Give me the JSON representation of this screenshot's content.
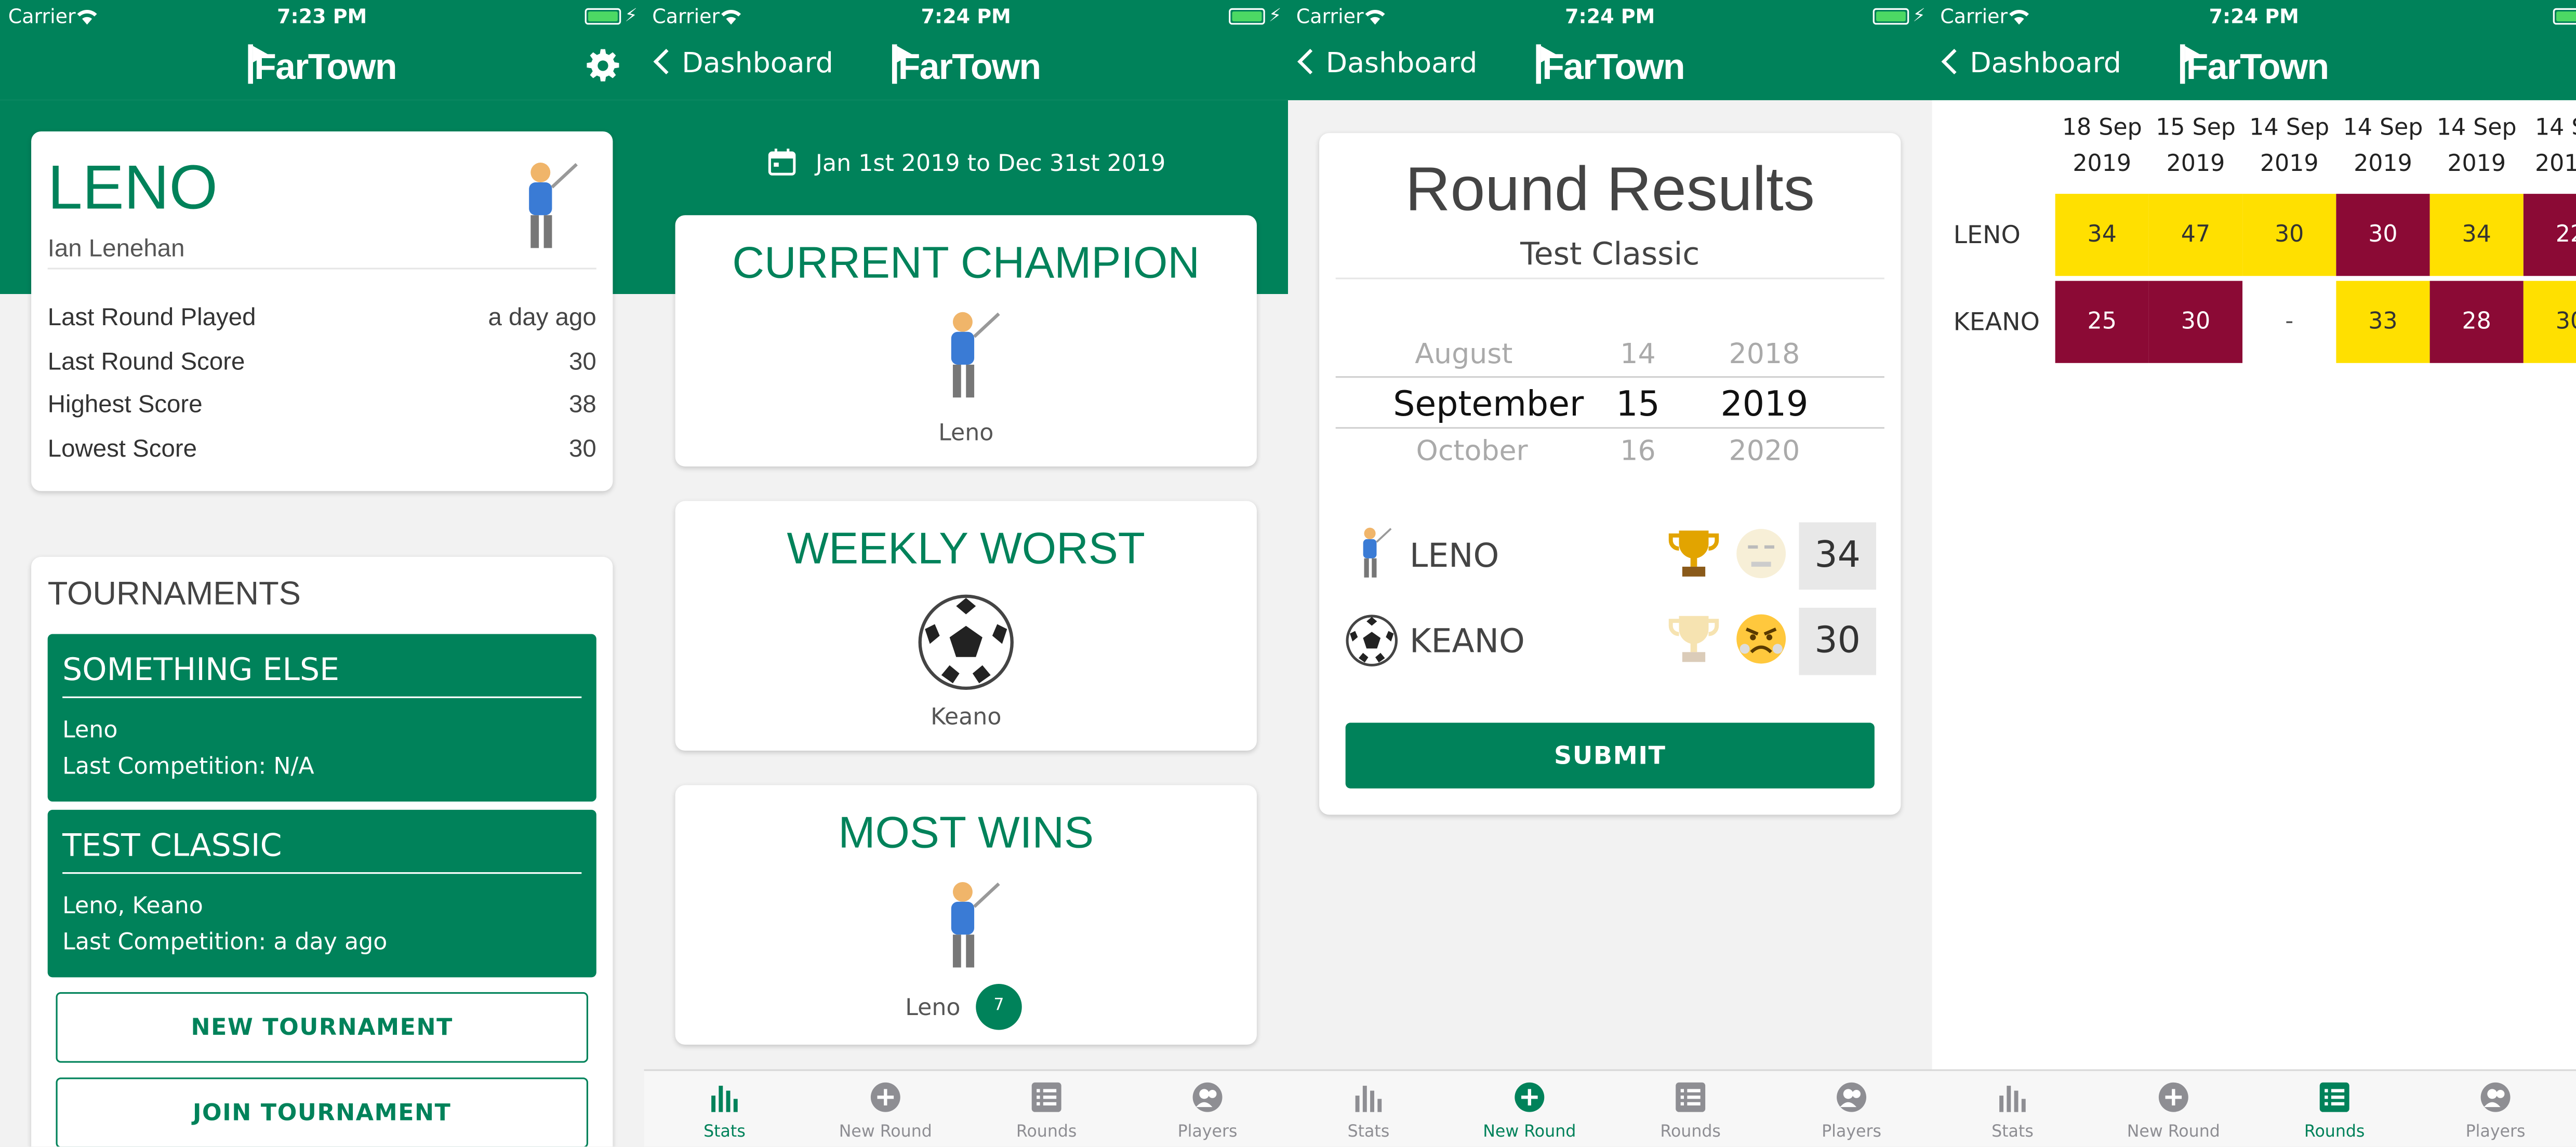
{
  "status": {
    "carrier": "Carrier",
    "times": [
      "7:23 PM",
      "7:24 PM",
      "7:24 PM",
      "7:24 PM"
    ]
  },
  "app": {
    "logo": "FarTown",
    "back_label": "Dashboard",
    "accent": "#00825a"
  },
  "tabs": [
    "Stats",
    "New Round",
    "Rounds",
    "Players"
  ],
  "profile": {
    "name": "LENO",
    "full_name": "Ian Lenehan",
    "avatar_icon": "golfer-emoji",
    "stats": [
      {
        "label": "Last Round Played",
        "value": "a day ago"
      },
      {
        "label": "Last Round Score",
        "value": "30"
      },
      {
        "label": "Highest Score",
        "value": "38"
      },
      {
        "label": "Lowest Score",
        "value": "30"
      }
    ]
  },
  "tournaments": {
    "heading": "TOURNAMENTS",
    "items": [
      {
        "name": "SOMETHING ELSE",
        "players": "Leno",
        "last": "Last Competition: N/A"
      },
      {
        "name": "TEST CLASSIC",
        "players": "Leno, Keano",
        "last": "Last Competition: a day ago"
      }
    ],
    "new_label": "NEW TOURNAMENT",
    "join_label": "JOIN TOURNAMENT"
  },
  "dashboard": {
    "date_range": "Jan 1st 2019 to Dec 31st 2019",
    "cards": [
      {
        "title": "CURRENT CHAMPION",
        "icon": "golfer-emoji",
        "name": "Leno"
      },
      {
        "title": "WEEKLY WORST",
        "icon": "soccer-ball-emoji",
        "name": "Keano"
      },
      {
        "title": "MOST WINS",
        "icon": "golfer-emoji",
        "name": "Leno",
        "count": "7"
      }
    ]
  },
  "round": {
    "title": "Round Results",
    "subtitle": "Test Classic",
    "picker": {
      "months": [
        "August",
        "September",
        "October"
      ],
      "days": [
        "14",
        "15",
        "16"
      ],
      "years": [
        "2018",
        "2019",
        "2020"
      ]
    },
    "players": [
      {
        "name": "LENO",
        "icon": "golfer-emoji",
        "trophy_active": true,
        "face_active": false,
        "score": "34"
      },
      {
        "name": "KEANO",
        "icon": "soccer-ball-emoji",
        "trophy_active": false,
        "face_active": true,
        "score": "30"
      }
    ],
    "submit_label": "SUBMIT"
  },
  "rounds": {
    "columns": [
      {
        "day": "18 Sep",
        "year": "2019"
      },
      {
        "day": "15 Sep",
        "year": "2019"
      },
      {
        "day": "14 Sep",
        "year": "2019"
      },
      {
        "day": "14 Sep",
        "year": "2019"
      },
      {
        "day": "14 Sep",
        "year": "2019"
      },
      {
        "day": "14 S",
        "year": "201"
      }
    ],
    "rows": [
      {
        "name": "LENO",
        "cells": [
          {
            "v": "34",
            "c": "y"
          },
          {
            "v": "47",
            "c": "y"
          },
          {
            "v": "30",
            "c": "y"
          },
          {
            "v": "30",
            "c": "r"
          },
          {
            "v": "34",
            "c": "y"
          },
          {
            "v": "22",
            "c": "r"
          }
        ]
      },
      {
        "name": "KEANO",
        "cells": [
          {
            "v": "25",
            "c": "r"
          },
          {
            "v": "30",
            "c": "r"
          },
          {
            "v": "-",
            "c": "n"
          },
          {
            "v": "33",
            "c": "y"
          },
          {
            "v": "28",
            "c": "r"
          },
          {
            "v": "30",
            "c": "y"
          }
        ]
      }
    ],
    "colors": {
      "win": "#ffe000",
      "loss": "#8b0a35"
    }
  }
}
